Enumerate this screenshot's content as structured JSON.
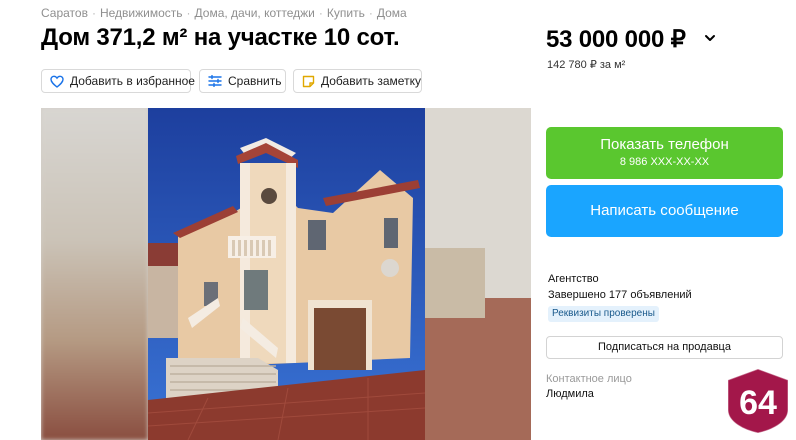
{
  "breadcrumbs": [
    "Саратов",
    "Недвижимость",
    "Дома, дачи, коттеджи",
    "Купить",
    "Дома"
  ],
  "breadcrumb_separator": "·",
  "listing": {
    "title": "Дом 371,2 м² на участке 10 сот.",
    "price": "53 000 000 ₽",
    "price_per_m2": "142 780 ₽ за м²"
  },
  "actions": {
    "favorite": "Добавить в избранное",
    "compare": "Сравнить",
    "note": "Добавить заметку"
  },
  "contact": {
    "show_phone": "Показать телефон",
    "phone_masked": "8 986 XXX-XX-XX",
    "message": "Написать сообщение"
  },
  "seller": {
    "type": "Агентство",
    "completed_ads": "Завершено 177 объявлений",
    "verified_badge": "Реквизиты проверены",
    "subscribe": "Подписаться на продавца",
    "contact_label": "Контактное лицо",
    "contact_name": "Людмила"
  },
  "watermark": {
    "text": "64",
    "color": "#a3174a"
  },
  "colors": {
    "phone_button": "#5ac72f",
    "message_button": "#1aa5ff",
    "verified_badge_bg": "#e4f1fc",
    "favorite_icon": "#1a73e8"
  }
}
